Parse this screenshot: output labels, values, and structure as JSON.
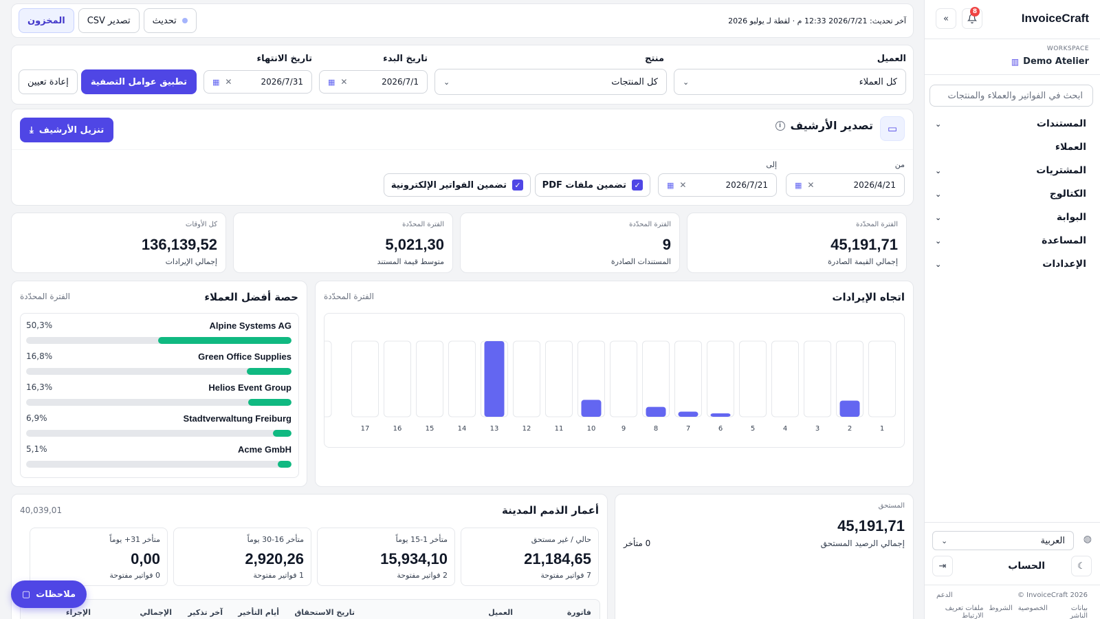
{
  "app": {
    "brand": "InvoiceCraft",
    "notifications_count": "8"
  },
  "workspace": {
    "label": "WORKSPACE",
    "name": "Demo Atelier"
  },
  "search": {
    "placeholder": "ابحث في الفواتير والعملاء والمنتجات"
  },
  "nav": [
    {
      "label": "المستندات",
      "has_children": true
    },
    {
      "label": "العملاء",
      "has_children": false
    },
    {
      "label": "المشتريات",
      "has_children": true
    },
    {
      "label": "الكتالوج",
      "has_children": true
    },
    {
      "label": "البوابة",
      "has_children": true
    },
    {
      "label": "المساعدة",
      "has_children": true
    },
    {
      "label": "الإعدادات",
      "has_children": true
    }
  ],
  "language": {
    "selected": "العربية"
  },
  "account": {
    "label": "الحساب"
  },
  "footer": {
    "copyright": "InvoiceCraft 2026 ©",
    "support": "الدعم",
    "links": [
      "بيانات الناشر",
      "الخصوصية",
      "الشروط",
      "ملفات تعريف الارتباط"
    ]
  },
  "topbar": {
    "updated": "آخر تحديث: 2026/7/21 12:33 م · لقطة لـ يوليو 2026",
    "refresh_label": "تحديث",
    "export_csv_label": "تصدير CSV",
    "inventory_label": "المخزون"
  },
  "filters": {
    "customer_label": "العميل",
    "customer_value": "كل العملاء",
    "product_label": "منتج",
    "product_value": "كل المنتجات",
    "start_label": "تاريخ البدء",
    "start_value": "2026/7/1",
    "end_label": "تاريخ الانتهاء",
    "end_value": "2026/7/31",
    "apply_label": "تطبيق عوامل التصفية",
    "reset_label": "إعادة تعيين"
  },
  "archive": {
    "title": "تصدير الأرشيف",
    "download_label": "تنزيل الأرشيف",
    "from_label": "من",
    "from_value": "2026/4/21",
    "to_label": "إلى",
    "to_value": "2026/7/21",
    "include_pdf": "تضمين ملفات PDF",
    "include_einvoices": "تضمين الفواتير الإلكترونية"
  },
  "stats": [
    {
      "period": "الفترة المحدّدة",
      "value": "45,191,71",
      "label": "إجمالي القيمة الصادرة"
    },
    {
      "period": "الفترة المحدّدة",
      "value": "9",
      "label": "المستندات الصادرة"
    },
    {
      "period": "الفترة المحدّدة",
      "value": "5,021,30",
      "label": "متوسط قيمة المستند"
    },
    {
      "period": "كل الأوقات",
      "value": "136,139,52",
      "label": "إجمالي الإيرادات"
    }
  ],
  "trend": {
    "title": "اتجاه الإيرادات",
    "subtitle": "الفترة المحدّدة"
  },
  "chart_data": {
    "type": "bar",
    "title": "اتجاه الإيرادات",
    "categories": [
      "1",
      "2",
      "3",
      "4",
      "5",
      "6",
      "7",
      "8",
      "9",
      "10",
      "11",
      "12",
      "13",
      "14",
      "15",
      "16",
      "17"
    ],
    "values": [
      0,
      2200,
      0,
      0,
      0,
      350,
      700,
      1350,
      0,
      2300,
      0,
      0,
      10300,
      0,
      0,
      0,
      0
    ],
    "ylim": [
      0,
      10300
    ],
    "grid": false,
    "colors": {
      "bar": "#6366f1",
      "track": "#e5e7eb"
    }
  },
  "share": {
    "title": "حصة أفضل العملاء",
    "subtitle": "الفترة المحدّدة",
    "customers": [
      {
        "name": "Alpine Systems AG",
        "pct_label": "50,3%",
        "pct": 50.3
      },
      {
        "name": "Green Office Supplies",
        "pct_label": "16,8%",
        "pct": 16.8
      },
      {
        "name": "Helios Event Group",
        "pct_label": "16,3%",
        "pct": 16.3
      },
      {
        "name": "Stadtverwaltung Freiburg",
        "pct_label": "6,9%",
        "pct": 6.9
      },
      {
        "name": "Acme GmbH",
        "pct_label": "5,1%",
        "pct": 5.1
      }
    ],
    "bar_color": "#10b981"
  },
  "due": {
    "label": "المستحق",
    "value": "45,191,71",
    "sub": "إجمالي الرصيد المستحق",
    "overdue": "0 متأخر"
  },
  "aging": {
    "title": "أعمار الذمم المدينة",
    "total": "40,039,01",
    "buckets": [
      {
        "label": "حالي / غير مستحق",
        "value": "21,184,65",
        "count": "7 فواتير مفتوحة"
      },
      {
        "label": "متأخر 1-15 يوماً",
        "value": "15,934,10",
        "count": "2 فواتير مفتوحة"
      },
      {
        "label": "متأخر 16-30 يوماً",
        "value": "2,920,26",
        "count": "1 فواتير مفتوحة"
      },
      {
        "label": "متأخر 31+ يوماً",
        "value": "0,00",
        "count": "0 فواتير مفتوحة"
      }
    ],
    "columns": [
      "فاتورة",
      "العميل",
      "تاريخ الاستحقاق",
      "أيام التأخير",
      "آخر تذكير",
      "الإجمالي",
      "الإجراء"
    ]
  },
  "notes": {
    "label": "ملاحظات"
  }
}
